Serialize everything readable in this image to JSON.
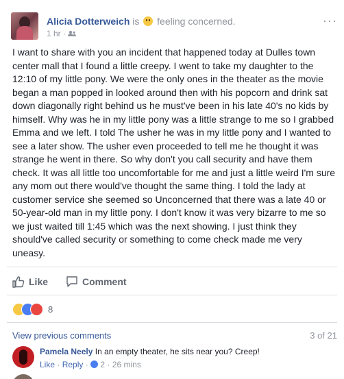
{
  "post": {
    "author": "Alicia Dotterweich",
    "feeling_prefix": "is",
    "feeling_text": "feeling concerned.",
    "time": "1 hr",
    "separator": "·",
    "audience_icon": "friends-icon",
    "more_label": "···",
    "body": "I want to share with you an incident that happened today at Dulles town center mall that I found a little creepy. I went to take my daughter to the 12:10 of my little pony. We were the only ones in the theater as the movie began a man popped in looked around then with his popcorn and drink sat down diagonally right behind us he must've been in his late 40's no kids by himself. Why was he in my little pony was a little strange to me so I grabbed Emma and we left. I told The usher he was in my little pony and I wanted to see a later show. The usher even proceeded to tell me he thought it was strange he went in there. So why don't you call security and have them check. It was all little too uncomfortable for me and just a little weird I'm sure any mom out there would've thought the same thing. I told the lady at customer service she seemed so Unconcerned that there was a late 40 or 50-year-old man in my little pony. I don't know it was very bizarre to me so we just waited till 1:45 which was the next showing. I just think they should've called security or something to come check made me very uneasy."
  },
  "actions": {
    "like_label": "Like",
    "comment_label": "Comment"
  },
  "reactions": {
    "icons": [
      "wow-icon",
      "like-icon",
      "angry-icon"
    ],
    "count": "8"
  },
  "comments_nav": {
    "view_previous": "View previous comments",
    "count": "3 of 21"
  },
  "comment": {
    "author": "Pamela Neely",
    "text": "In an empty theater, he sits near you? Creep!",
    "like": "Like",
    "reply": "Reply",
    "likes": "2",
    "time": "26 mins",
    "sep": "·"
  },
  "colors": {
    "link": "#365899",
    "text": "#1d2129",
    "muted": "#90949c",
    "like_blue": "#4a7ef0"
  }
}
